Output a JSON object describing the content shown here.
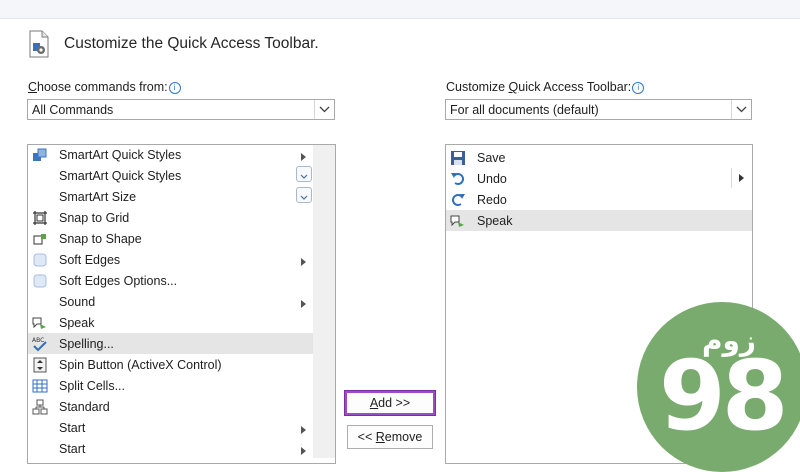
{
  "dialog": {
    "title": "Customize the Quick Access Toolbar.",
    "icon": "document-settings-icon"
  },
  "left": {
    "label_first": "C",
    "label_rest": "hoose commands from:",
    "combo_value": "All Commands",
    "items": [
      {
        "label": "SmartArt Quick Styles",
        "icon": "smartart-styles-icon",
        "submenu": true
      },
      {
        "label": "SmartArt Quick Styles",
        "icon": "",
        "submenu": false
      },
      {
        "label": "SmartArt Size",
        "icon": "",
        "submenu": false
      },
      {
        "label": "Snap to Grid",
        "icon": "snap-grid-icon",
        "submenu": false
      },
      {
        "label": "Snap to Shape",
        "icon": "snap-shape-icon",
        "submenu": false
      },
      {
        "label": "Soft Edges",
        "icon": "soft-edges-icon",
        "submenu": true
      },
      {
        "label": "Soft Edges Options...",
        "icon": "soft-edges-options-icon",
        "submenu": false
      },
      {
        "label": "Sound",
        "icon": "",
        "submenu": true
      },
      {
        "label": "Speak",
        "icon": "speak-icon",
        "submenu": false
      },
      {
        "label": "Spelling...",
        "icon": "spelling-icon",
        "submenu": false,
        "selected": true
      },
      {
        "label": "Spin Button (ActiveX Control)",
        "icon": "spin-button-icon",
        "submenu": false
      },
      {
        "label": "Split Cells...",
        "icon": "split-cells-icon",
        "submenu": false
      },
      {
        "label": "Standard",
        "icon": "standard-icon",
        "submenu": false
      },
      {
        "label": "Start",
        "icon": "",
        "submenu": true
      },
      {
        "label": "Start",
        "icon": "",
        "submenu": true
      }
    ]
  },
  "right": {
    "label_pre": "Customize ",
    "label_ul": "Q",
    "label_post": "uick Access Toolbar:",
    "combo_value": "For all documents (default)",
    "items": [
      {
        "label": "Save",
        "icon": "save-icon"
      },
      {
        "label": "Undo",
        "icon": "undo-icon",
        "submenu": true
      },
      {
        "label": "Redo",
        "icon": "redo-icon"
      },
      {
        "label": "Speak",
        "icon": "speak-icon",
        "selected": true
      }
    ]
  },
  "buttons": {
    "add_ul": "A",
    "add_rest": "dd >>",
    "remove_pre": "<< ",
    "remove_ul": "R",
    "remove_rest": "emove"
  },
  "watermark": {
    "text": "زوم",
    "number": "98",
    "color": "#7aab6e"
  }
}
